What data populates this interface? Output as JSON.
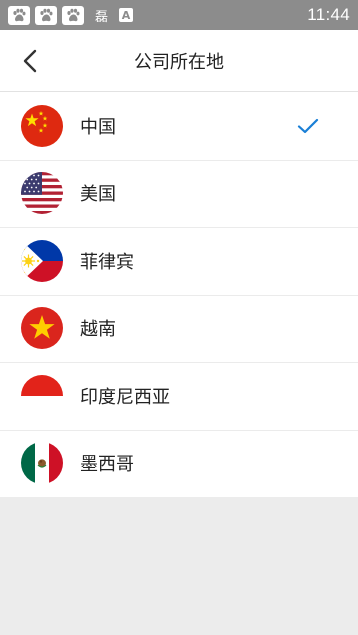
{
  "status_bar": {
    "time": "11:44",
    "icons": [
      "paw-icon",
      "paw-icon",
      "paw-icon",
      "storage-icon",
      "a-icon"
    ],
    "storage_glyph": "磊",
    "a_glyph": "A"
  },
  "header": {
    "title": "公司所在地",
    "back_icon": "chevron-left-icon"
  },
  "countries": [
    {
      "label": "中国",
      "flag": "china-flag-icon",
      "selected": true
    },
    {
      "label": "美国",
      "flag": "usa-flag-icon",
      "selected": false
    },
    {
      "label": "菲律宾",
      "flag": "philippines-flag-icon",
      "selected": false
    },
    {
      "label": "越南",
      "flag": "vietnam-flag-icon",
      "selected": false
    },
    {
      "label": "印度尼西亚",
      "flag": "indonesia-flag-icon",
      "selected": false
    },
    {
      "label": "墨西哥",
      "flag": "mexico-flag-icon",
      "selected": false
    }
  ],
  "colors": {
    "accent": "#1a7fd6",
    "status_bar": "#8c8c8c",
    "background": "#ececec"
  }
}
